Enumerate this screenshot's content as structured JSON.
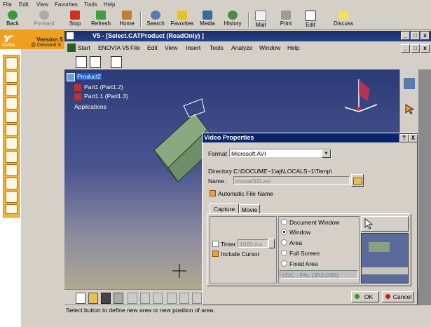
{
  "ie_menu": [
    "File",
    "Edit",
    "View",
    "Favorites",
    "Tools",
    "Help"
  ],
  "ie_toolbar": {
    "back": "Back",
    "forward": "Forward",
    "stop": "Stop",
    "refresh": "Refresh",
    "home": "Home",
    "search": "Search",
    "favorites": "Favorites",
    "media": "Media",
    "history": "History",
    "mail": "Mail",
    "print": "Print",
    "edit": "Edit",
    "discuss": "Discuss"
  },
  "catia_banner": {
    "version": "Version 5",
    "company": "@ Dassault S",
    "logo": "CATIA"
  },
  "cat_window": {
    "title": "V5 - [Select.CATProduct (ReadOnly) ]"
  },
  "cat_menu": [
    "Start",
    "ENOVIA V5",
    "File",
    "Edit",
    "View",
    "Insert",
    "Tools",
    "Analyze",
    "Window",
    "Help"
  ],
  "tree": {
    "root": "Product2",
    "children": [
      "Part1 (Part1.2)",
      "Part1.1 (Part1.3)",
      "Applications"
    ]
  },
  "status_text": "Select button to define new area or new position of area.",
  "dialog": {
    "title": "Video Properties",
    "help_glyph": "?",
    "close_glyph": "X",
    "format_label": "Format :",
    "format_value": "Microsoft AVI",
    "directory_label": "Directory :",
    "directory_value": "C:\\DOCUME~1\\ajt\\LOCALS~1\\Temp\\",
    "name_label": "Name :",
    "name_value": "movie000.avi",
    "auto_name_label": "Automatic File Name",
    "tabs": [
      "Capture",
      "Movie"
    ],
    "timer_label": "Timer",
    "timer_value": "1000 ms",
    "include_cursor_label": "Include Cursor",
    "radio_options": [
      "Document Window",
      "Window",
      "Area",
      "Full Screen",
      "Fixed Area"
    ],
    "fixed_area_value": "VDC - PAL (352x288)",
    "ok_label": "OK",
    "cancel_label": "Cancel"
  },
  "colors": {
    "catia_orange": "#f0a020",
    "dialog_title": "#0a246a",
    "window_title": "#1a2e66"
  }
}
